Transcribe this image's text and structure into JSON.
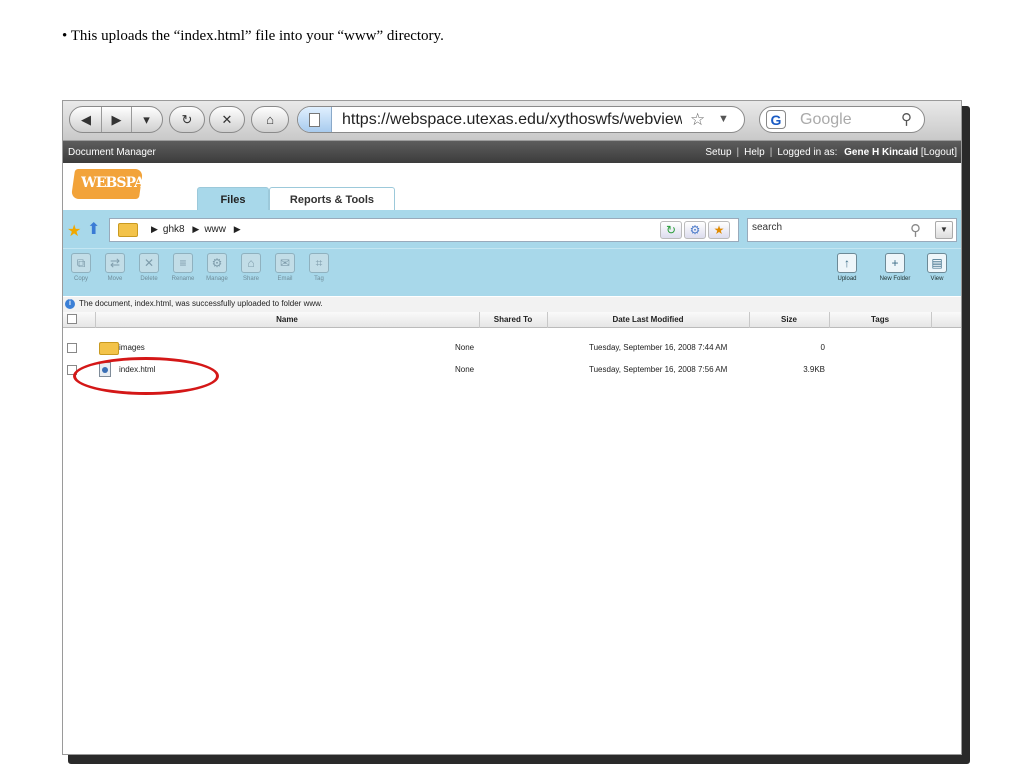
{
  "caption": "• This uploads the “index.html” file into your “www” directory.",
  "browser": {
    "back": "◀",
    "forward": "▶",
    "history": "▾",
    "reload": "↻",
    "stop": "✕",
    "home": "⌂",
    "url": "https://webspace.utexas.edu/xythoswfs/webview/fileManager",
    "search_engine_glyph": "G",
    "search_placeholder": "Google"
  },
  "app": {
    "title": "Document Manager",
    "links": [
      "Setup",
      "Help"
    ],
    "logged_in_label": "Logged in as:",
    "user": "Gene H Kincaid",
    "logout": "[Logout]"
  },
  "logo": "WEBSPACE",
  "tabs": [
    {
      "label": "Files",
      "active": true
    },
    {
      "label": "Reports & Tools",
      "active": false
    }
  ],
  "breadcrumb": [
    "ghk8",
    "www"
  ],
  "search": {
    "value": "search"
  },
  "toolbar_left": [
    {
      "label": "Copy",
      "icon": "copy-icon"
    },
    {
      "label": "Move",
      "icon": "move-icon"
    },
    {
      "label": "Delete",
      "icon": "delete-icon"
    },
    {
      "label": "Rename",
      "icon": "rename-icon"
    },
    {
      "label": "Manage",
      "icon": "manage-icon"
    },
    {
      "label": "Share",
      "icon": "share-icon"
    },
    {
      "label": "Email",
      "icon": "email-icon"
    },
    {
      "label": "Tag",
      "icon": "tag-icon"
    }
  ],
  "toolbar_right": [
    {
      "label": "Upload",
      "icon": "upload-icon"
    },
    {
      "label": "New Folder",
      "icon": "new-folder-icon"
    },
    {
      "label": "View",
      "icon": "view-icon"
    }
  ],
  "status_message": "The document, index.html, was successfully uploaded to folder www.",
  "columns": [
    "Name",
    "Shared To",
    "Date Last Modified",
    "Size",
    "Tags"
  ],
  "rows": [
    {
      "name": "images",
      "shared": "None",
      "modified": "Tuesday, September 16, 2008 7:44 AM",
      "size": "0",
      "tags": "",
      "type": "folder"
    },
    {
      "name": "index.html",
      "shared": "None",
      "modified": "Tuesday, September 16, 2008 7:56 AM",
      "size": "3.9KB",
      "tags": "",
      "type": "file"
    }
  ],
  "colors": {
    "accent": "#a8d8ea",
    "header": "#4a4a4a",
    "highlight": "#d41717",
    "logo": "#f2a33a"
  }
}
